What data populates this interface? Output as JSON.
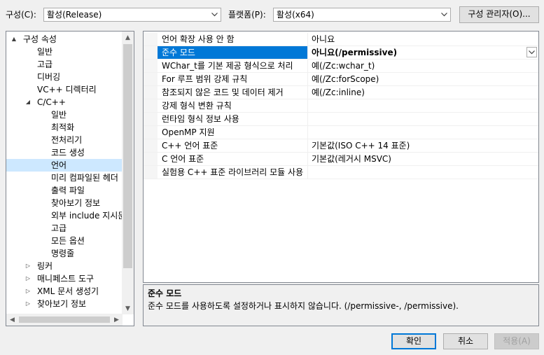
{
  "toolbar": {
    "config_label": "구성(C):",
    "config_value": "활성(Release)",
    "platform_label": "플랫폼(P):",
    "platform_value": "활성(x64)",
    "config_manager_button": "구성 관리자(O)..."
  },
  "tree": {
    "items": [
      {
        "label": "구성 속성",
        "expander": "▲"
      },
      {
        "label": "일반",
        "expander": ""
      },
      {
        "label": "고급",
        "expander": ""
      },
      {
        "label": "디버깅",
        "expander": ""
      },
      {
        "label": "VC++ 디렉터리",
        "expander": ""
      },
      {
        "label": "C/C++",
        "expander": "◢"
      },
      {
        "label": "일반",
        "expander": ""
      },
      {
        "label": "최적화",
        "expander": ""
      },
      {
        "label": "전처리기",
        "expander": ""
      },
      {
        "label": "코드 생성",
        "expander": ""
      },
      {
        "label": "언어",
        "expander": ""
      },
      {
        "label": "미리 컴파일된 헤더",
        "expander": ""
      },
      {
        "label": "출력 파일",
        "expander": ""
      },
      {
        "label": "찾아보기 정보",
        "expander": ""
      },
      {
        "label": "외부 include 지시문",
        "expander": ""
      },
      {
        "label": "고급",
        "expander": ""
      },
      {
        "label": "모든 옵션",
        "expander": ""
      },
      {
        "label": "명령줄",
        "expander": ""
      },
      {
        "label": "링커",
        "expander": "▷"
      },
      {
        "label": "매니페스트 도구",
        "expander": "▷"
      },
      {
        "label": "XML 문서 생성기",
        "expander": "▷"
      },
      {
        "label": "찾아보기 정보",
        "expander": "▷"
      }
    ]
  },
  "grid": {
    "rows": [
      {
        "name": "언어 확장 사용 안 함",
        "value": "아니요"
      },
      {
        "name": "준수 모드",
        "value": "아니요(/permissive)"
      },
      {
        "name": "WChar_t를 기본 제공 형식으로 처리",
        "value": "예(/Zc:wchar_t)"
      },
      {
        "name": "For 루프 범위 강제 규칙",
        "value": "예(/Zc:forScope)"
      },
      {
        "name": "참조되지 않은 코드 및 데이터 제거",
        "value": "예(/Zc:inline)"
      },
      {
        "name": "강제 형식 변환 규칙",
        "value": ""
      },
      {
        "name": "런타임 형식 정보 사용",
        "value": ""
      },
      {
        "name": "OpenMP 지원",
        "value": ""
      },
      {
        "name": "C++ 언어 표준",
        "value": "기본값(ISO C++ 14 표준)"
      },
      {
        "name": "C 언어 표준",
        "value": "기본값(레거시 MSVC)"
      },
      {
        "name": "실험용 C++ 표준 라이브러리 모듈 사용",
        "value": ""
      }
    ]
  },
  "description": {
    "title": "준수 모드",
    "text": "준수 모드를 사용하도록 설정하거나 표시하지 않습니다. (/permissive-, /permissive)."
  },
  "buttons": {
    "ok": "확인",
    "cancel": "취소",
    "apply": "적용(A)"
  }
}
